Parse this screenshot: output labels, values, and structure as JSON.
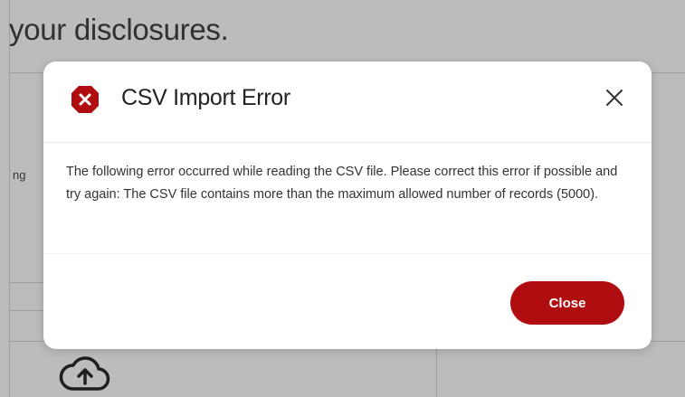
{
  "background": {
    "heading": "your disclosures.",
    "side_text": "ng"
  },
  "dialog": {
    "title": "CSV Import Error",
    "icon": "error-hexagon-icon",
    "close_icon": "close-icon",
    "message": "The following error occurred while reading the CSV file. Please correct this error if possible and try again: The CSV file contains more than the maximum allowed number of records (5000).",
    "close_button_label": "Close"
  },
  "colors": {
    "accent": "#b00d10",
    "overlay": "#3c3c3c"
  }
}
